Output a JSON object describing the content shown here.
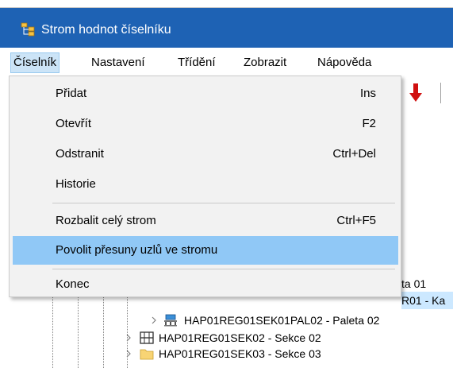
{
  "window": {
    "title": "Strom hodnot číselníku",
    "app_icon": "tree-structure-icon"
  },
  "menubar": {
    "items": [
      "Číselník",
      "Nastavení",
      "Třídění",
      "Zobrazit",
      "Nápověda"
    ],
    "active": "Číselník"
  },
  "toolbar": {
    "buttons": [
      {
        "icon": "arrow-down-red-icon"
      }
    ]
  },
  "dropdown": {
    "items": [
      {
        "label": "Přidat",
        "shortcut": "Ins"
      },
      {
        "label": "Otevřít",
        "shortcut": "F2"
      },
      {
        "label": "Odstranit",
        "shortcut": "Ctrl+Del"
      },
      {
        "label": "Historie",
        "shortcut": ""
      },
      {
        "label": "Rozbalit celý strom",
        "shortcut": "Ctrl+F5"
      },
      {
        "label": "Povolit přesuny uzlů ve stromu",
        "shortcut": "",
        "highlighted": true
      },
      {
        "label": "Konec",
        "shortcut": ""
      }
    ]
  },
  "tree": {
    "rows": [
      {
        "label": "ta 01",
        "icon": "pallet-icon"
      },
      {
        "label": "R01 - Ka",
        "icon": "box-icon",
        "selected": true
      },
      {
        "label": "HAP01REG01SEK01PAL02 - Paleta 02",
        "icon": "pallet-icon"
      },
      {
        "label": "HAP01REG01SEK02 - Sekce 02",
        "icon": "shelf-section-icon"
      },
      {
        "label": "HAP01REG01SEK03 - Sekce 03",
        "icon": "folder-icon"
      }
    ]
  },
  "colors": {
    "titlebar": "#1e62b4",
    "menu_active": "#cce4f7",
    "menu_hover": "#90c8f6",
    "selection": "#cce8ff",
    "toolbar_arrow": "#d01010"
  }
}
